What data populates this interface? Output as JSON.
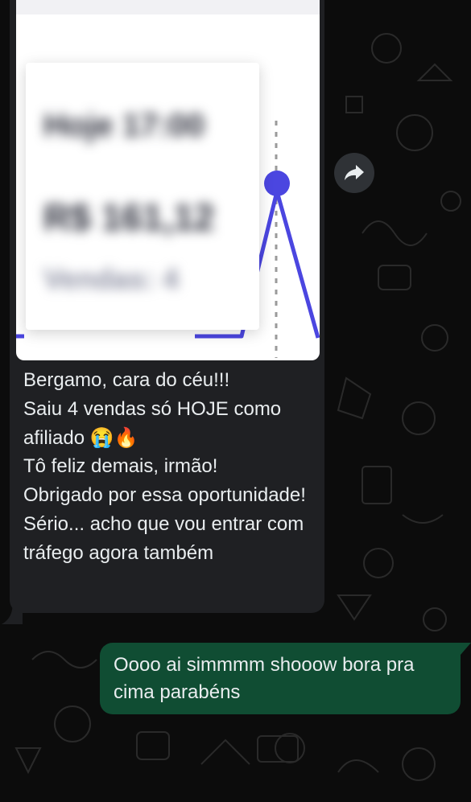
{
  "colors": {
    "wallpaper": "#0c0c0c",
    "incoming_bubble": "#1f2023",
    "outgoing_bubble": "#104d33",
    "text": "#e9edef",
    "chart_line": "#4b46e0"
  },
  "media": {
    "blurred_lines": [
      "Hoje 17:00",
      "R$ 161,12",
      "Vendas: 4"
    ]
  },
  "incoming_message": {
    "text": "Bergamo, cara do céu!!!\nSaiu 4 vendas só HOJE como afiliado 😭🔥\nTô feliz demais, irmão!\nObrigado por essa oportunidade!\nSério... acho que vou entrar com tráfego agora também"
  },
  "outgoing_message": {
    "text": "Oooo ai simmmm shooow bora pra cima parabéns"
  },
  "icons": {
    "forward": "forward-icon"
  }
}
